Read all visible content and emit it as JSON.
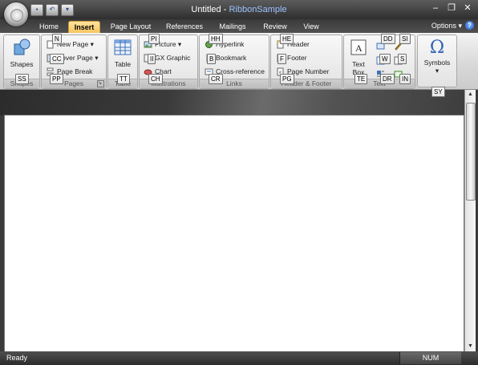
{
  "window": {
    "title": "Untitled",
    "title_sep": " - ",
    "app_name": "RibbonSample"
  },
  "qat": {
    "items": [
      "save-icon",
      "undo-icon",
      "customize-icon"
    ]
  },
  "window_controls": {
    "minimize": "–",
    "restore": "❐",
    "close": "✕"
  },
  "tabs": [
    {
      "label": "Home",
      "active": false
    },
    {
      "label": "Insert",
      "active": true
    },
    {
      "label": "Page Layout",
      "active": false
    },
    {
      "label": "References",
      "active": false
    },
    {
      "label": "Mailings",
      "active": false
    },
    {
      "label": "Review",
      "active": false
    },
    {
      "label": "View",
      "active": false
    }
  ],
  "options_label": "Options",
  "options_arrow": "▾",
  "help_label": "?",
  "groups": {
    "shapes": {
      "label": "Shapes",
      "button": "Shapes",
      "keytip": "SS"
    },
    "pages": {
      "label": "Pages",
      "new_page": "New Page",
      "cover_page": "Cover Page",
      "page_break": "Page Break",
      "keytip_n": "N",
      "keytip_cc": "CC",
      "keytip_pp": "PP"
    },
    "table": {
      "label": "Table",
      "button": "Table",
      "keytip": "TT"
    },
    "illustrations": {
      "label": "Illustrations",
      "picture": "Picture",
      "gx_graphic": "GX Graphic",
      "chart": "Chart",
      "keytip_pi": "PI",
      "keytip_ii": "II",
      "keytip_ch": "CH"
    },
    "links": {
      "label": "Links",
      "hyperlink": "Hyperlink",
      "bookmark": "Bookmark",
      "cross_reference": "Cross-reference",
      "keytip_hh": "HH",
      "keytip_b": "B",
      "keytip_cr": "CR"
    },
    "header_footer": {
      "label": "Header & Footer",
      "header": "Header",
      "footer": "Footer",
      "page_number": "Page Number",
      "keytip_he": "HE",
      "keytip_f": "F",
      "keytip_pg": "PG"
    },
    "text": {
      "label": "Text",
      "text_box": "Text Box",
      "text_box_arrow": "▾",
      "keytip_dd": "DD",
      "keytip_si": "SI",
      "keytip_w": "W",
      "keytip_s": "S",
      "keytip_te": "TE",
      "keytip_dr": "DR",
      "keytip_in": "IN"
    },
    "symbols": {
      "button": "Symbols",
      "glyph": "Ω",
      "keytip": "SY"
    }
  },
  "status": {
    "ready": "Ready",
    "num": "NUM"
  }
}
